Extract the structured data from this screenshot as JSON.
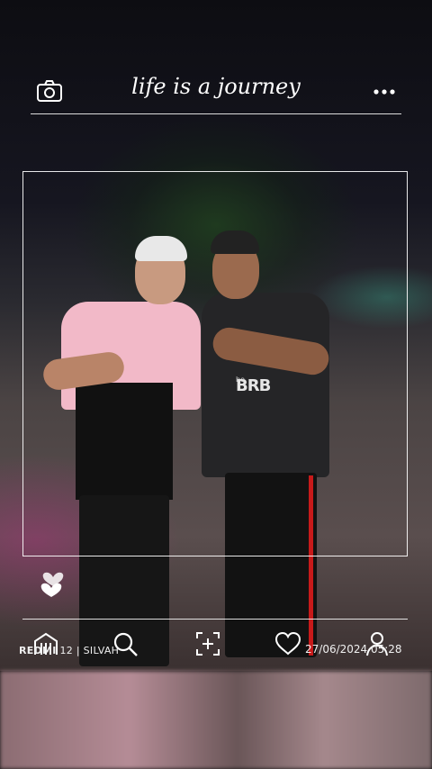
{
  "header": {
    "title": "life is a journey",
    "camera_icon": "camera-icon",
    "more_icon": "more-dots-icon"
  },
  "photo": {
    "shirt_brand": "BRB",
    "shirt_brand_small": "bo"
  },
  "footer": {
    "watermark_brand": "REDMI",
    "watermark_rest": " 12 | SILVAH",
    "datetime": "27/06/2024  05:28",
    "icons": [
      "hearts-icon",
      "building-icon",
      "search-icon",
      "scan-plus-icon",
      "heart-icon",
      "user-icon"
    ]
  },
  "colors": {
    "overlay": "#ffffff",
    "accent_pink": "#f2b9c8",
    "stripe_red": "#c71a1a"
  }
}
